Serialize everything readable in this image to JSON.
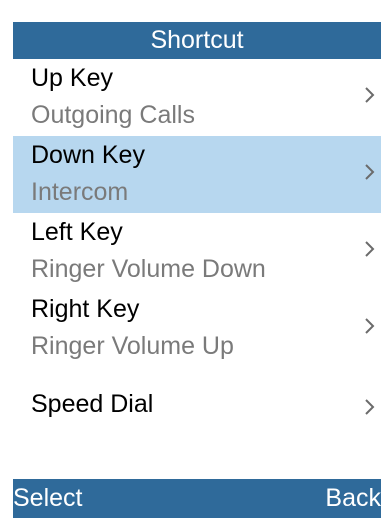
{
  "title": "Shortcut",
  "menu": {
    "items": [
      {
        "label": "Up Key",
        "value": "Outgoing Calls",
        "selected": false,
        "icon": "chevron-right-icon"
      },
      {
        "label": "Down Key",
        "value": "Intercom",
        "selected": true,
        "icon": "chevron-right-icon"
      },
      {
        "label": "Left Key",
        "value": "Ringer Volume Down",
        "selected": false,
        "icon": "chevron-right-icon"
      },
      {
        "label": "Right Key",
        "value": "Ringer Volume Up",
        "selected": false,
        "icon": "chevron-right-icon"
      },
      {
        "label": "Speed Dial",
        "selected": false,
        "icon": "chevron-right-icon"
      }
    ]
  },
  "softkeys": {
    "left": "Select",
    "right": "Back"
  },
  "colors": {
    "bar": "#2f6a9a",
    "selected_row": "#b7d7ef",
    "secondary_text": "#7a7a7a",
    "chevron": "#6b6b6b"
  }
}
